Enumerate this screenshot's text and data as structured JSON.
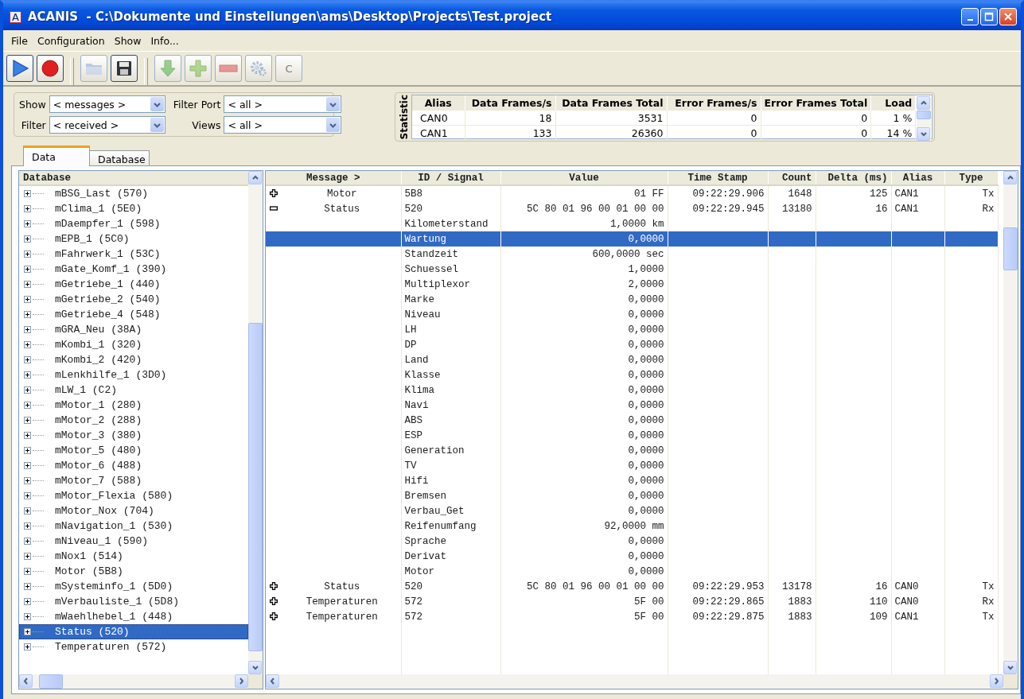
{
  "window": {
    "icon_letter": "A",
    "title": "ACANIS  - C:\\Dokumente und Einstellungen\\ams\\Desktop\\Projects\\Test.project"
  },
  "menu": [
    "File",
    "Configuration",
    "Show",
    "Info..."
  ],
  "toolbar": [
    {
      "kind": "play",
      "disabled": false
    },
    {
      "kind": "record",
      "disabled": false
    },
    {
      "kind": "separator"
    },
    {
      "kind": "open",
      "disabled": true
    },
    {
      "kind": "save",
      "disabled": false
    },
    {
      "kind": "separator"
    },
    {
      "kind": "import",
      "disabled": true
    },
    {
      "kind": "add",
      "disabled": true
    },
    {
      "kind": "remove",
      "disabled": true
    },
    {
      "kind": "settings",
      "disabled": true
    },
    {
      "kind": "text",
      "label": "C",
      "disabled": true
    }
  ],
  "filters": [
    {
      "label": "Show",
      "value": "< messages >"
    },
    {
      "label": "Filter Port",
      "value": "< all >"
    },
    {
      "label": "Filter",
      "value": "< received >"
    },
    {
      "label": "Views",
      "value": "< all >"
    }
  ],
  "statistic": {
    "title": "Statistic",
    "columns": [
      "Alias",
      "Data Frames/s",
      "Data Frames Total",
      "Error Frames/s",
      "Error Frames Total",
      "Load"
    ],
    "rows": [
      [
        "CAN0",
        "18",
        "3531",
        "0",
        "0",
        "1 %"
      ],
      [
        "CAN1",
        "133",
        "26360",
        "0",
        "0",
        "14 %"
      ]
    ]
  },
  "tabs": [
    {
      "label": "Data",
      "selected": true
    },
    {
      "label": "Database",
      "selected": false
    }
  ],
  "tree": {
    "header": "Database",
    "items": [
      {
        "label": "mBSG_Last (570)",
        "expanded": false,
        "selected": false
      },
      {
        "label": "mClima_1 (5E0)",
        "expanded": false,
        "selected": false
      },
      {
        "label": "mDaempfer_1 (598)",
        "expanded": false,
        "selected": false
      },
      {
        "label": "mEPB_1 (5C0)",
        "expanded": false,
        "selected": false
      },
      {
        "label": "mFahrwerk_1 (53C)",
        "expanded": false,
        "selected": false
      },
      {
        "label": "mGate_Komf_1 (390)",
        "expanded": false,
        "selected": false
      },
      {
        "label": "mGetriebe_1 (440)",
        "expanded": false,
        "selected": false
      },
      {
        "label": "mGetriebe_2 (540)",
        "expanded": false,
        "selected": false
      },
      {
        "label": "mGetriebe_4 (548)",
        "expanded": false,
        "selected": false
      },
      {
        "label": "mGRA_Neu (38A)",
        "expanded": false,
        "selected": false
      },
      {
        "label": "mKombi_1 (320)",
        "expanded": false,
        "selected": false
      },
      {
        "label": "mKombi_2 (420)",
        "expanded": false,
        "selected": false
      },
      {
        "label": "mLenkhilfe_1 (3D0)",
        "expanded": false,
        "selected": false
      },
      {
        "label": "mLW_1 (C2)",
        "expanded": false,
        "selected": false
      },
      {
        "label": "mMotor_1 (280)",
        "expanded": false,
        "selected": false
      },
      {
        "label": "mMotor_2 (288)",
        "expanded": false,
        "selected": false
      },
      {
        "label": "mMotor_3 (380)",
        "expanded": false,
        "selected": false
      },
      {
        "label": "mMotor_5 (480)",
        "expanded": false,
        "selected": false
      },
      {
        "label": "mMotor_6 (488)",
        "expanded": false,
        "selected": false
      },
      {
        "label": "mMotor_7 (588)",
        "expanded": false,
        "selected": false
      },
      {
        "label": "mMotor_Flexia (580)",
        "expanded": false,
        "selected": false
      },
      {
        "label": "mMotor_Nox (704)",
        "expanded": false,
        "selected": false
      },
      {
        "label": "mNavigation_1 (530)",
        "expanded": false,
        "selected": false
      },
      {
        "label": "mNiveau_1 (590)",
        "expanded": false,
        "selected": false
      },
      {
        "label": "mNox1 (514)",
        "expanded": false,
        "selected": false
      },
      {
        "label": "Motor (5B8)",
        "expanded": false,
        "selected": false
      },
      {
        "label": "mSysteminfo_1 (5D0)",
        "expanded": false,
        "selected": false
      },
      {
        "label": "mVerbauliste_1 (5D8)",
        "expanded": false,
        "selected": false
      },
      {
        "label": "mWaehlhebel_1 (448)",
        "expanded": false,
        "selected": false
      },
      {
        "label": "Status (520)",
        "expanded": false,
        "selected": true
      },
      {
        "label": "Temperaturen (572)",
        "expanded": false,
        "selected": false
      }
    ]
  },
  "table": {
    "columns": [
      "Message >",
      "ID / Signal",
      "Value",
      "Time Stamp",
      "Count",
      "Delta (ms)",
      "Alias",
      "Type"
    ],
    "rows": [
      {
        "kind": "message",
        "expanded": false,
        "selected": false,
        "message": "Motor",
        "id": "5B8",
        "value": "01 FF",
        "time": "09:22:29.906",
        "count": "1648",
        "delta": "125",
        "alias": "CAN1",
        "type": "Tx"
      },
      {
        "kind": "message",
        "expanded": true,
        "selected": false,
        "message": "Status",
        "id": "520",
        "value": "5C 80 01 96 00 01 00 00",
        "time": "09:22:29.945",
        "count": "13180",
        "delta": "16",
        "alias": "CAN1",
        "type": "Rx"
      },
      {
        "kind": "signal",
        "selected": false,
        "id": "Kilometerstand",
        "value": "1,0000 km"
      },
      {
        "kind": "signal",
        "selected": true,
        "id": "Wartung",
        "value": "0,0000"
      },
      {
        "kind": "signal",
        "selected": false,
        "id": "Standzeit",
        "value": "600,0000 sec"
      },
      {
        "kind": "signal",
        "selected": false,
        "id": "Schuessel",
        "value": "1,0000"
      },
      {
        "kind": "signal",
        "selected": false,
        "id": "Multiplexor",
        "value": "2,0000"
      },
      {
        "kind": "signal",
        "selected": false,
        "id": "Marke",
        "value": "0,0000"
      },
      {
        "kind": "signal",
        "selected": false,
        "id": "Niveau",
        "value": "0,0000"
      },
      {
        "kind": "signal",
        "selected": false,
        "id": "LH",
        "value": "0,0000"
      },
      {
        "kind": "signal",
        "selected": false,
        "id": "DP",
        "value": "0,0000"
      },
      {
        "kind": "signal",
        "selected": false,
        "id": "Land",
        "value": "0,0000"
      },
      {
        "kind": "signal",
        "selected": false,
        "id": "Klasse",
        "value": "0,0000"
      },
      {
        "kind": "signal",
        "selected": false,
        "id": "Klima",
        "value": "0,0000"
      },
      {
        "kind": "signal",
        "selected": false,
        "id": "Navi",
        "value": "0,0000"
      },
      {
        "kind": "signal",
        "selected": false,
        "id": "ABS",
        "value": "0,0000"
      },
      {
        "kind": "signal",
        "selected": false,
        "id": "ESP",
        "value": "0,0000"
      },
      {
        "kind": "signal",
        "selected": false,
        "id": "Generation",
        "value": "0,0000"
      },
      {
        "kind": "signal",
        "selected": false,
        "id": "TV",
        "value": "0,0000"
      },
      {
        "kind": "signal",
        "selected": false,
        "id": "Hifi",
        "value": "0,0000"
      },
      {
        "kind": "signal",
        "selected": false,
        "id": "Bremsen",
        "value": "0,0000"
      },
      {
        "kind": "signal",
        "selected": false,
        "id": "Verbau_Get",
        "value": "0,0000"
      },
      {
        "kind": "signal",
        "selected": false,
        "id": "Reifenumfang",
        "value": "92,0000 mm"
      },
      {
        "kind": "signal",
        "selected": false,
        "id": "Sprache",
        "value": "0,0000"
      },
      {
        "kind": "signal",
        "selected": false,
        "id": "Derivat",
        "value": "0,0000"
      },
      {
        "kind": "signal",
        "selected": false,
        "id": "Motor",
        "value": "0,0000"
      },
      {
        "kind": "message",
        "expanded": false,
        "selected": false,
        "message": "Status",
        "id": "520",
        "value": "5C 80 01 96 00 01 00 00",
        "time": "09:22:29.953",
        "count": "13178",
        "delta": "16",
        "alias": "CAN0",
        "type": "Tx"
      },
      {
        "kind": "message",
        "expanded": false,
        "selected": false,
        "message": "Temperaturen",
        "id": "572",
        "value": "5F 00",
        "time": "09:22:29.865",
        "count": "1883",
        "delta": "110",
        "alias": "CAN0",
        "type": "Rx"
      },
      {
        "kind": "message",
        "expanded": false,
        "selected": false,
        "message": "Temperaturen",
        "id": "572",
        "value": "5F 00",
        "time": "09:22:29.875",
        "count": "1883",
        "delta": "109",
        "alias": "CAN1",
        "type": "Tx"
      }
    ]
  }
}
